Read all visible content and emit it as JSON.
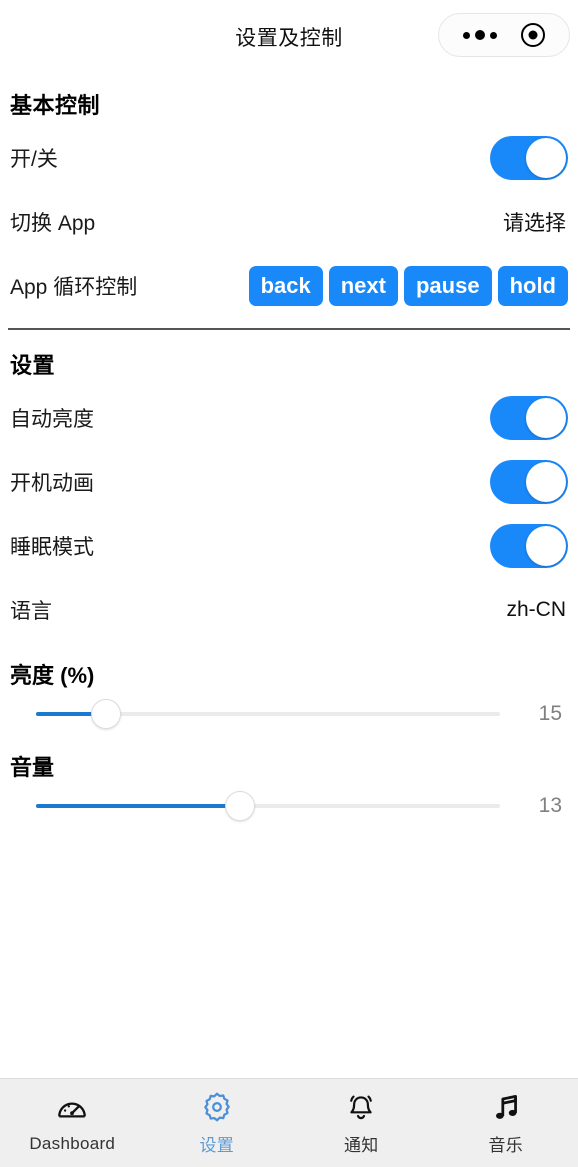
{
  "header": {
    "title": "设置及控制",
    "capsule": {
      "more_icon": "more-dots-icon",
      "target_icon": "target-icon"
    }
  },
  "sections": [
    {
      "title": "基本控制",
      "rows": {
        "power": {
          "label": "开/关",
          "state": "on"
        },
        "switch_app": {
          "label": "切换 App",
          "value": "请选择"
        },
        "app_loop": {
          "label": "App 循环控制",
          "buttons": [
            "back",
            "next",
            "pause",
            "hold"
          ]
        }
      }
    },
    {
      "title": "设置",
      "rows": {
        "auto_brightness": {
          "label": "自动亮度",
          "state": "on"
        },
        "boot_animation": {
          "label": "开机动画",
          "state": "on"
        },
        "sleep_mode": {
          "label": "睡眠模式",
          "state": "on"
        },
        "language": {
          "label": "语言",
          "value": "zh-CN"
        }
      },
      "sliders": [
        {
          "label": "亮度 (%)",
          "value": "15",
          "percent": 15
        },
        {
          "label": "音量",
          "value": "13",
          "percent": 44
        }
      ]
    }
  ],
  "tabs": [
    {
      "label": "Dashboard",
      "icon": "gauge-icon",
      "active": false
    },
    {
      "label": "设置",
      "icon": "gear-icon",
      "active": true
    },
    {
      "label": "通知",
      "icon": "bell-icon",
      "active": false
    },
    {
      "label": "音乐",
      "icon": "music-note-icon",
      "active": false
    }
  ],
  "colors": {
    "accent_blue": "#1989fa",
    "tab_active_blue": "#5b9bd5",
    "slider_fill": "#1c79d0",
    "divider": "#555555"
  }
}
